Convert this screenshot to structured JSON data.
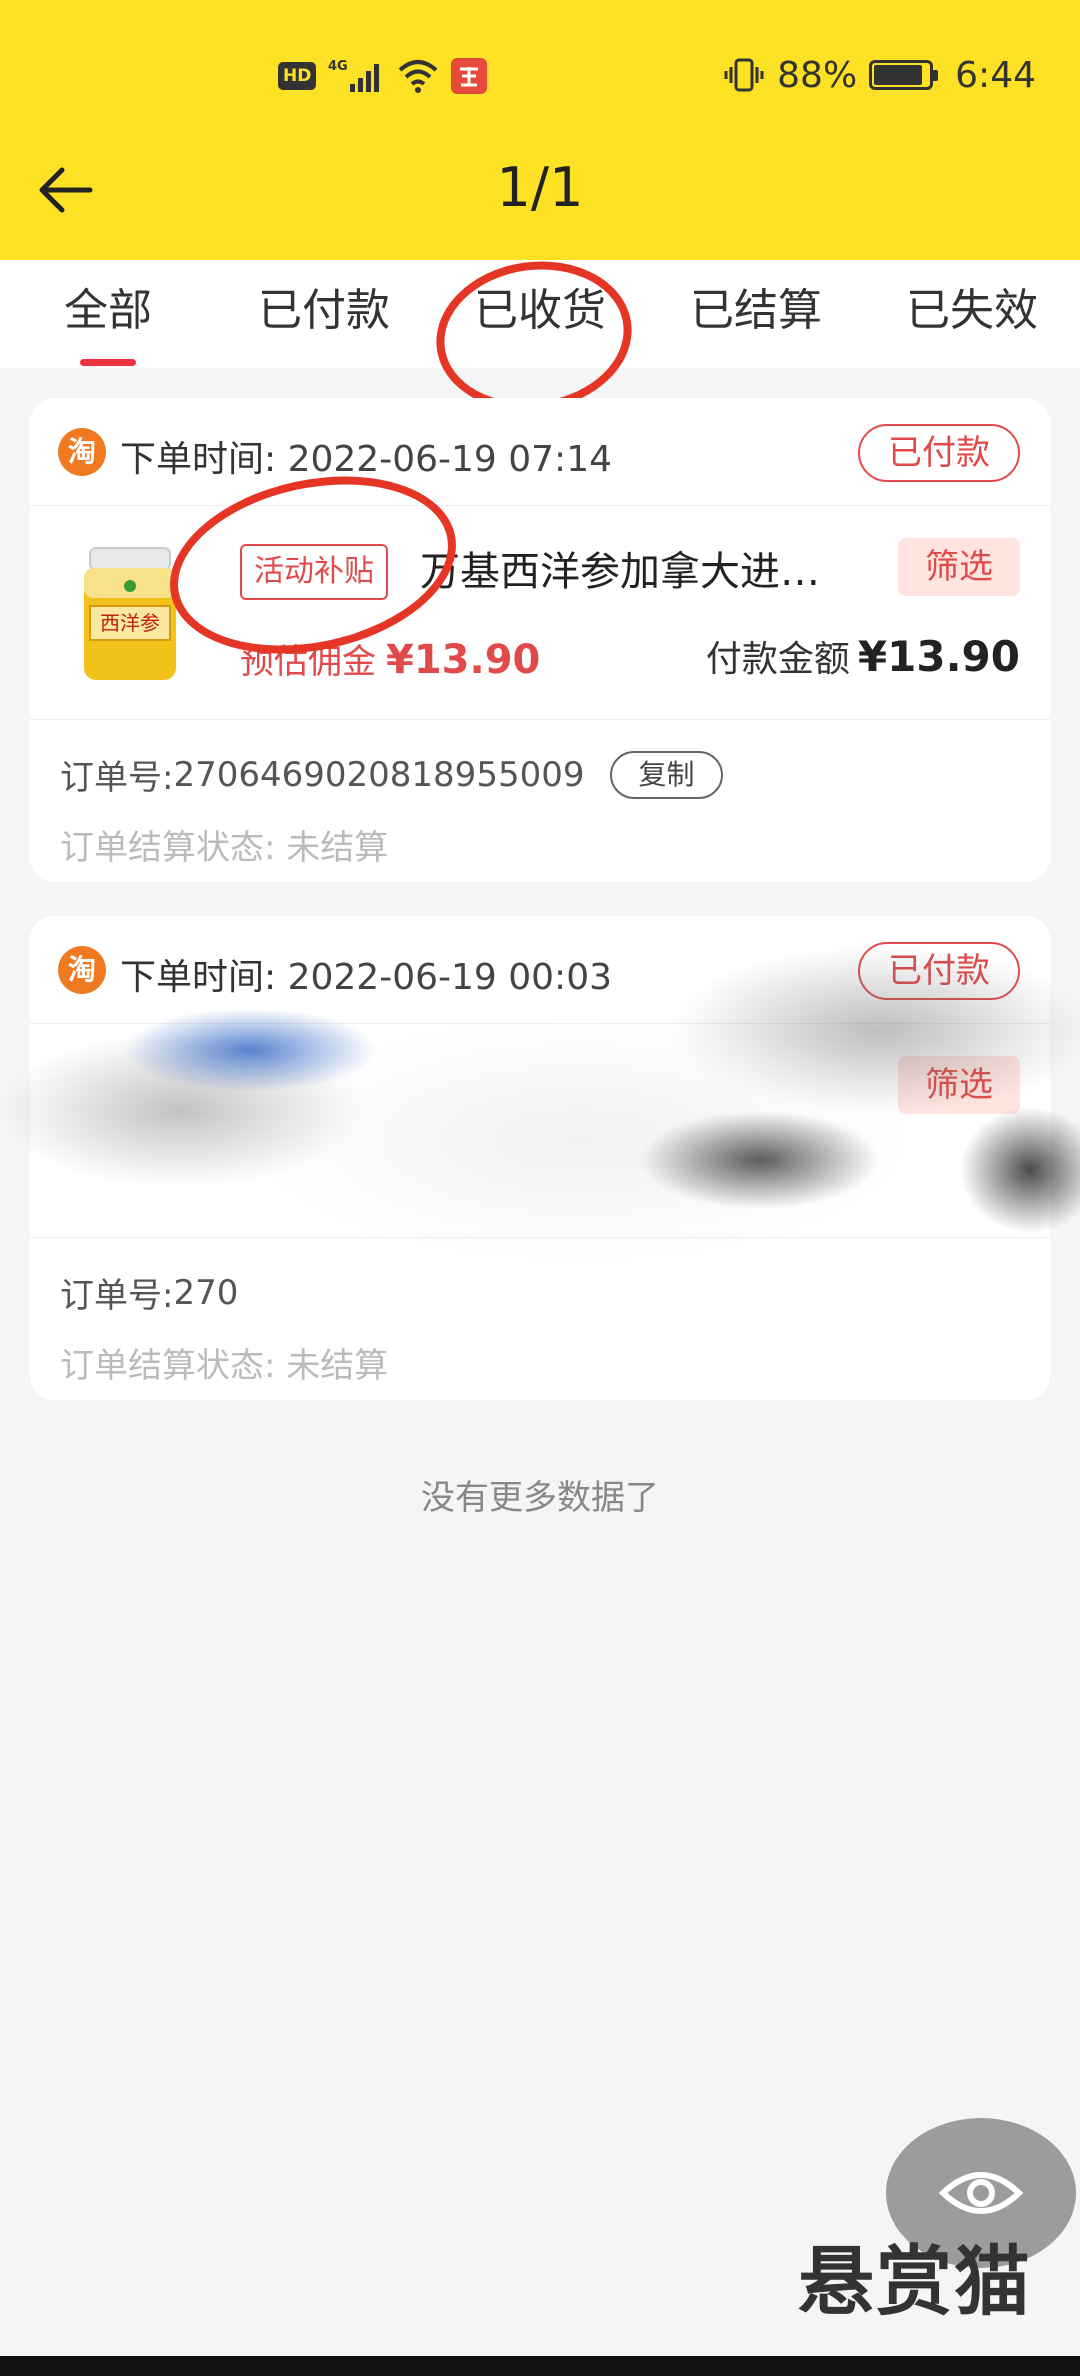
{
  "status_bar": {
    "hd_label": "HD",
    "network": "4G",
    "battery_percent": "88%",
    "battery_level": 0.88,
    "time": "6:44"
  },
  "nav": {
    "title": "1/1"
  },
  "tabs": [
    {
      "label": "全部",
      "active": true
    },
    {
      "label": "已付款",
      "active": false
    },
    {
      "label": "已收货",
      "active": false
    },
    {
      "label": "已结算",
      "active": false
    },
    {
      "label": "已失效",
      "active": false
    }
  ],
  "orders": [
    {
      "platform_icon": "淘",
      "time_label": "下单时间:",
      "time": "2022-06-19 07:14",
      "status": "已付款",
      "promo_tag": "活动补贴",
      "product_name": "万基西洋参加拿大进…",
      "product_image_text": "西洋参",
      "filter_label": "筛选",
      "commission_label": "预估佣金",
      "commission": "¥13.90",
      "pay_label": "付款金额",
      "pay_amount": "¥13.90",
      "order_no_label": "订单号:",
      "order_no": "2706469020818955009",
      "copy_label": "复制",
      "settle_label": "订单结算状态:",
      "settle_value": "未结算"
    },
    {
      "platform_icon": "淘",
      "time_label": "下单时间:",
      "time": "2022-06-19 00:03",
      "status": "已付款",
      "filter_label": "筛选",
      "order_no_label": "订单号:",
      "order_no": "270",
      "settle_label": "订单结算状态:",
      "settle_value": "未结算"
    }
  ],
  "footer": {
    "no_more": "没有更多数据了",
    "watermark": "悬赏猫"
  },
  "colors": {
    "header_bg": "#fde124",
    "accent_red": "#e04a4a",
    "annotation_red": "#e53524"
  }
}
